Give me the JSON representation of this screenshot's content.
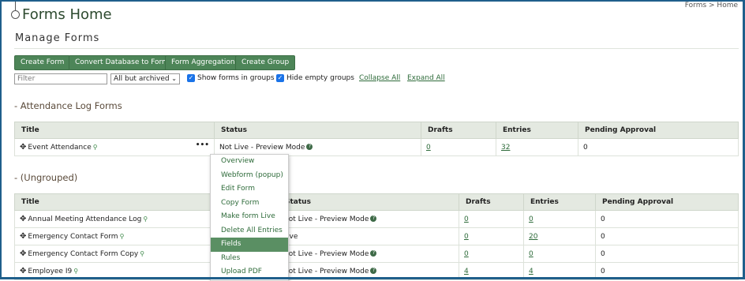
{
  "header": {
    "title": "Forms Home",
    "breadcrumb": "Forms > Home"
  },
  "section": {
    "title": "Manage Forms"
  },
  "toolbar": {
    "create_form": "Create Form",
    "convert_db": "Convert Database to Form",
    "aggregation": "Form Aggregation",
    "create_group": "Create Group"
  },
  "filters": {
    "filter_placeholder": "Filter",
    "select_value": "All but archived",
    "show_groups": "Show forms in groups",
    "hide_empty": "Hide empty groups",
    "collapse_all": "Collapse All",
    "expand_all": "Expand All"
  },
  "groups": [
    {
      "title": "-  Attendance Log Forms",
      "headers": [
        "Title",
        "Status",
        "Drafts",
        "Entries",
        "Pending Approval"
      ],
      "rows": [
        {
          "title": "Event Attendance",
          "status": "Not Live - Preview Mode",
          "drafts": "0",
          "entries": "32",
          "pending": "0"
        }
      ]
    },
    {
      "title": "-  (Ungrouped)",
      "headers": [
        "Title",
        "Status",
        "Drafts",
        "Entries",
        "Pending Approval"
      ],
      "rows": [
        {
          "title": "Annual Meeting Attendance Log",
          "status": "Not Live - Preview Mode",
          "drafts": "0",
          "entries": "0",
          "pending": "0"
        },
        {
          "title": "Emergency Contact Form",
          "status": "Live",
          "drafts": "0",
          "entries": "20",
          "pending": "0"
        },
        {
          "title": "Emergency Contact Form Copy",
          "status": "Not Live - Preview Mode",
          "drafts": "0",
          "entries": "0",
          "pending": "0"
        },
        {
          "title": "Employee I9",
          "status": "Not Live - Preview Mode",
          "drafts": "4",
          "entries": "4",
          "pending": "0"
        }
      ]
    }
  ],
  "context_menu": {
    "items": [
      "Overview",
      "Webform (popup)",
      "Edit Form",
      "Copy Form",
      "Make form Live",
      "Delete All Entries",
      "Fields",
      "Rules",
      "Upload PDF"
    ],
    "active": "Fields"
  },
  "icons": {
    "move": "move-icon",
    "tag": "tag-icon",
    "help": "help-icon",
    "more": "more-icon"
  }
}
